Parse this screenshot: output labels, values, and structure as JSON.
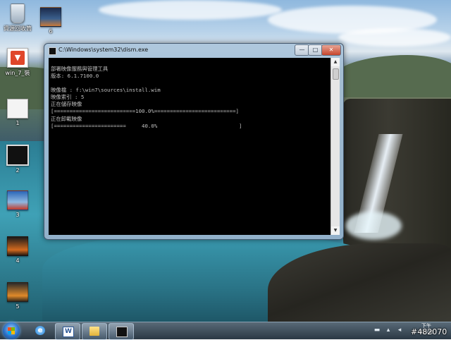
{
  "desktop": {
    "icons": [
      {
        "label": "資源回收筒",
        "icon": "recycle-bin-icon"
      },
      {
        "label": "6",
        "icon": "screenshot-thumbnail-icon"
      },
      {
        "label": "win_7_裝",
        "icon": "installer-icon"
      },
      {
        "label": "1",
        "icon": "screenshot-thumbnail-icon"
      },
      {
        "label": "2",
        "icon": "screenshot-thumbnail-icon"
      },
      {
        "label": "3",
        "icon": "screenshot-thumbnail-icon"
      },
      {
        "label": "4",
        "icon": "screenshot-thumbnail-icon"
      },
      {
        "label": "5",
        "icon": "screenshot-thumbnail-icon"
      }
    ]
  },
  "window": {
    "title": "C:\\Windows\\system32\\dism.exe",
    "buttons": {
      "minimize": "—",
      "maximize": "□",
      "close": "✕"
    },
    "console_lines": [
      "部署映像服務與管理工具",
      "版本: 6.1.7100.0",
      "",
      "映像檔 : f:\\win7\\sources\\install.wim",
      "映像索引 : 5",
      "正在儲存映像",
      "[==========================100.0%==========================]",
      "正在卸載映像",
      "[=======================     40.0%                          ]"
    ]
  },
  "taskbar": {
    "clock": {
      "period": "下午",
      "time": "01:06"
    },
    "apps": [
      "internet-explorer-icon",
      "word-document-icon",
      "explorer-folder-icon",
      "console-window-icon"
    ]
  },
  "watermark": "#482070",
  "colors": {
    "console_bg": "#000000",
    "console_text": "#c0c0c0",
    "taskbar": "#2f4354"
  }
}
